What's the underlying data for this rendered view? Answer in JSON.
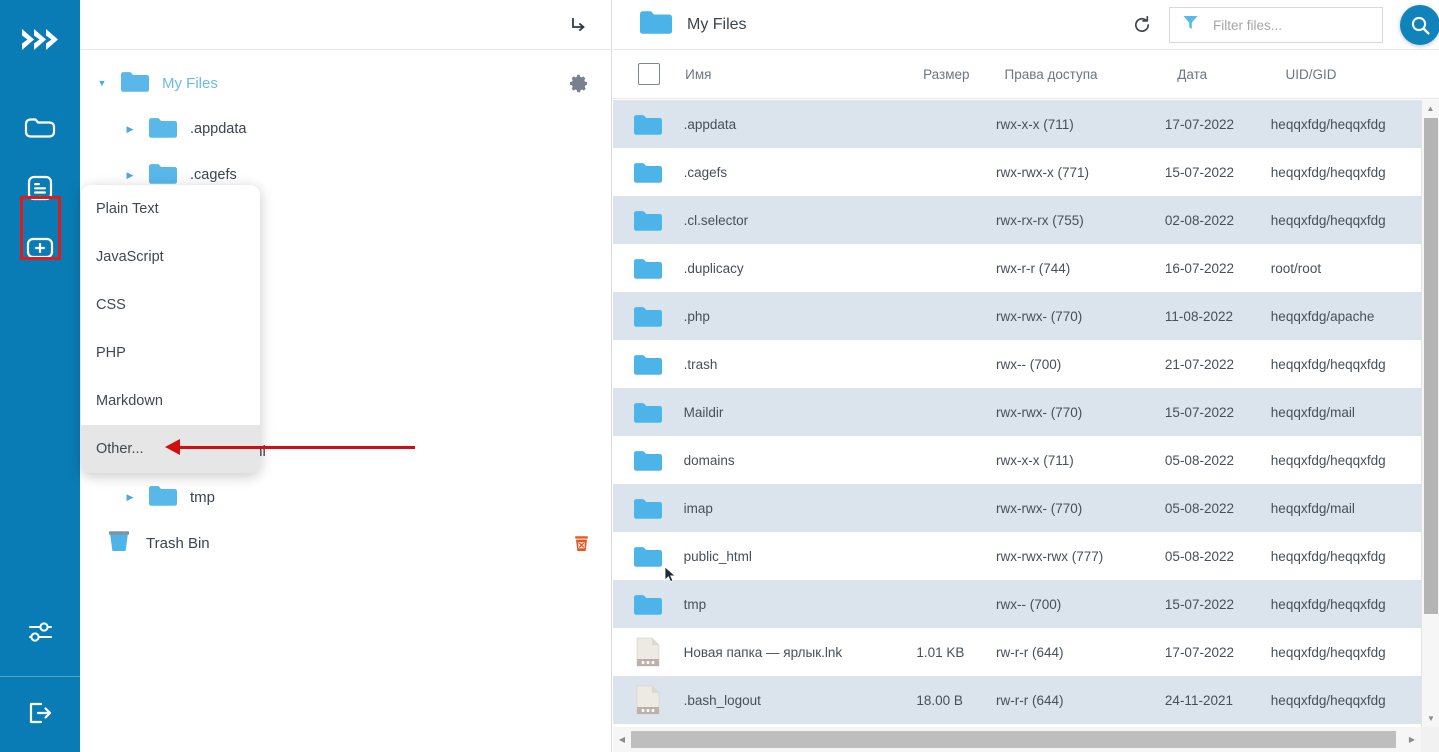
{
  "rail": {
    "logo_icon": "chevrons-right-logo",
    "items": [
      {
        "name": "file-manager",
        "icon": "folder-icon"
      },
      {
        "name": "file-editor",
        "icon": "document-lines-icon",
        "selected": true
      },
      {
        "name": "create-new",
        "icon": "plus-box-icon"
      }
    ],
    "bottom_items": [
      {
        "name": "settings",
        "icon": "sliders-icon"
      },
      {
        "name": "logout",
        "icon": "exit-icon"
      }
    ],
    "background": "#0a7cb5",
    "selection_outline": "#e01b1b"
  },
  "tree": {
    "collapse_icon": "arrow-turn-down-right-icon",
    "root": {
      "label": "My Files",
      "icon": "folder-icon",
      "expanded": true,
      "gear_icon": "gear-icon"
    },
    "items": [
      {
        "label": ".appdata",
        "icon": "folder-icon",
        "caret": "collapsed"
      },
      {
        "label": ".cagefs",
        "icon": "folder-icon",
        "caret": "collapsed"
      },
      {
        "label": "public_html",
        "icon": "folder-icon",
        "caret": "none"
      },
      {
        "label": "tmp",
        "icon": "folder-icon",
        "caret": "collapsed"
      }
    ],
    "trash": {
      "label": "Trash Bin",
      "icon": "trash-bin-icon",
      "delete_icon": "delete-trash-icon"
    }
  },
  "dropdown": {
    "items": [
      {
        "label": "Plain Text",
        "active": false
      },
      {
        "label": "JavaScript",
        "active": false
      },
      {
        "label": "CSS",
        "active": false
      },
      {
        "label": "PHP",
        "active": false
      },
      {
        "label": "Markdown",
        "active": false
      },
      {
        "label": "Other...",
        "active": true
      }
    ],
    "highlight_color": "#e6e6e6"
  },
  "annotation": {
    "arrow_color": "#cf0f12",
    "points_to": "Other..."
  },
  "files": {
    "title": "My Files",
    "title_icon": "folder-icon",
    "refresh_icon": "refresh-icon",
    "filter": {
      "icon": "funnel-icon",
      "value": "",
      "placeholder": "Filter files..."
    },
    "search_button": {
      "icon": "search-icon",
      "color": "#1083ba"
    },
    "columns": [
      {
        "key": "check",
        "label": ""
      },
      {
        "key": "name",
        "label": "Имя"
      },
      {
        "key": "size",
        "label": "Размер"
      },
      {
        "key": "perm",
        "label": "Права доступа"
      },
      {
        "key": "date",
        "label": "Дата"
      },
      {
        "key": "uid",
        "label": "UID/GID"
      }
    ],
    "rows": [
      {
        "icon": "folder-icon",
        "name": ".appdata",
        "size": "",
        "perm": "rwx-x-x (711)",
        "date": "17-07-2022",
        "uid": "heqqxfdg/heqqxfdg"
      },
      {
        "icon": "folder-icon",
        "name": ".cagefs",
        "size": "",
        "perm": "rwx-rwx-x (771)",
        "date": "15-07-2022",
        "uid": "heqqxfdg/heqqxfdg"
      },
      {
        "icon": "folder-icon",
        "name": ".cl.selector",
        "size": "",
        "perm": "rwx-rx-rx (755)",
        "date": "02-08-2022",
        "uid": "heqqxfdg/heqqxfdg"
      },
      {
        "icon": "folder-icon",
        "name": ".duplicacy",
        "size": "",
        "perm": "rwx-r-r (744)",
        "date": "16-07-2022",
        "uid": "root/root"
      },
      {
        "icon": "folder-icon",
        "name": ".php",
        "size": "",
        "perm": "rwx-rwx- (770)",
        "date": "11-08-2022",
        "uid": "heqqxfdg/apache"
      },
      {
        "icon": "folder-icon",
        "name": ".trash",
        "size": "",
        "perm": "rwx-- (700)",
        "date": "21-07-2022",
        "uid": "heqqxfdg/heqqxfdg"
      },
      {
        "icon": "folder-icon",
        "name": "Maildir",
        "size": "",
        "perm": "rwx-rwx- (770)",
        "date": "15-07-2022",
        "uid": "heqqxfdg/mail"
      },
      {
        "icon": "folder-icon",
        "name": "domains",
        "size": "",
        "perm": "rwx-x-x (711)",
        "date": "05-08-2022",
        "uid": "heqqxfdg/heqqxfdg"
      },
      {
        "icon": "folder-icon",
        "name": "imap",
        "size": "",
        "perm": "rwx-rwx- (770)",
        "date": "05-08-2022",
        "uid": "heqqxfdg/mail"
      },
      {
        "icon": "folder-icon",
        "name": "public_html",
        "size": "",
        "perm": "rwx-rwx-rwx (777)",
        "date": "05-08-2022",
        "uid": "heqqxfdg/heqqxfdg"
      },
      {
        "icon": "folder-icon",
        "name": "tmp",
        "size": "",
        "perm": "rwx-- (700)",
        "date": "15-07-2022",
        "uid": "heqqxfdg/heqqxfdg"
      },
      {
        "icon": "file-icon",
        "name": "Новая папка — ярлык.lnk",
        "size": "1.01 KB",
        "perm": "rw-r-r (644)",
        "date": "17-07-2022",
        "uid": "heqqxfdg/heqqxfdg"
      },
      {
        "icon": "file-icon",
        "name": ".bash_logout",
        "size": "18.00 B",
        "perm": "rw-r-r (644)",
        "date": "24-11-2021",
        "uid": "heqqxfdg/heqqxfdg"
      }
    ]
  }
}
